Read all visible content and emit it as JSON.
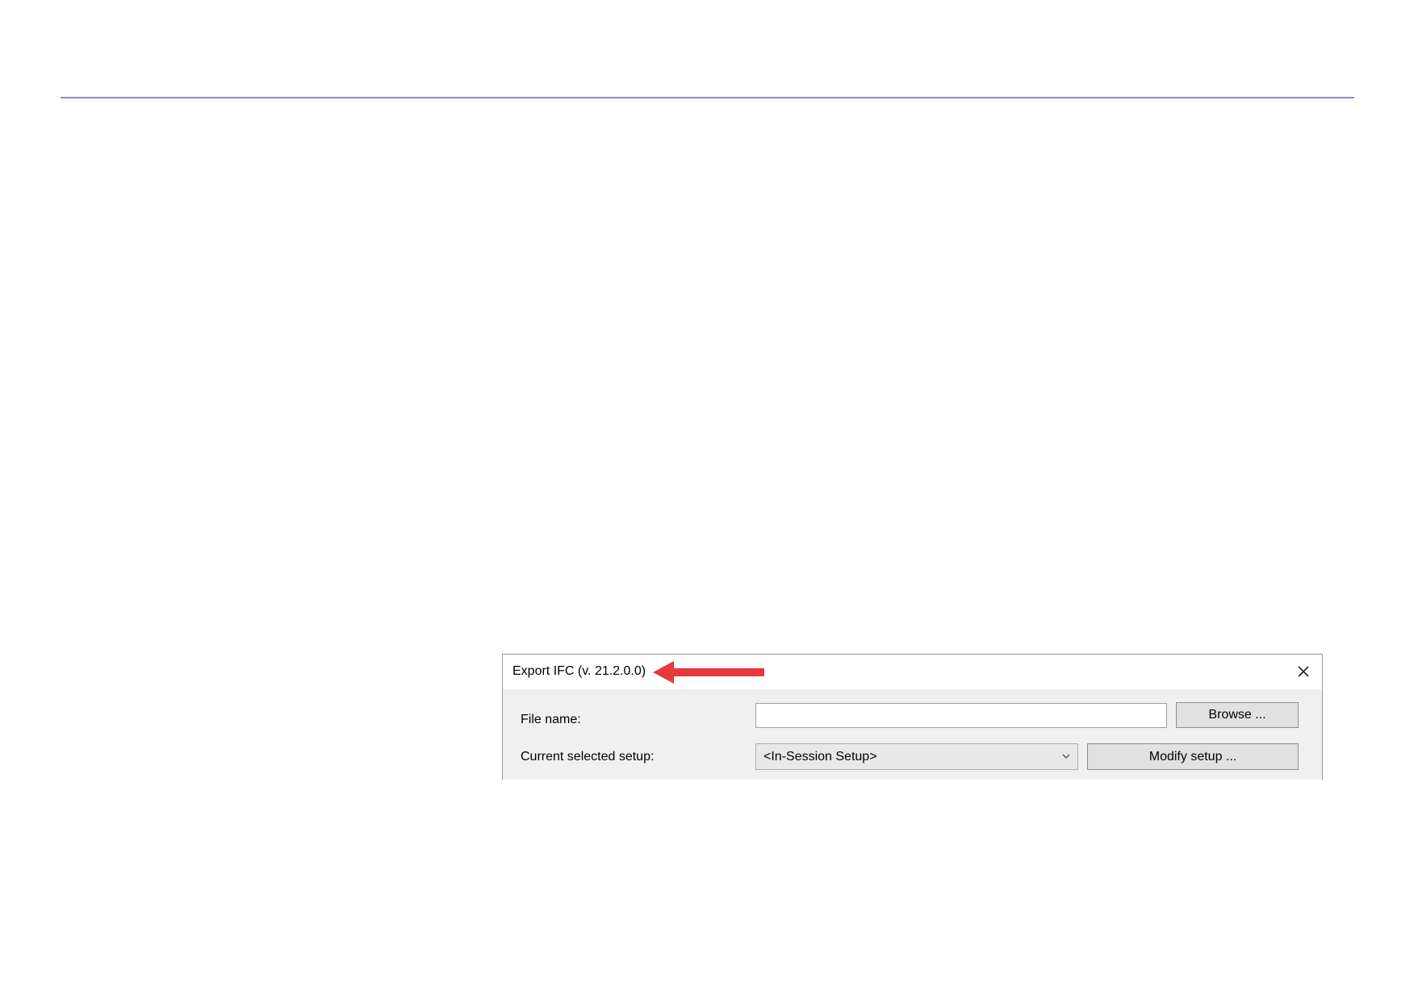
{
  "dialog": {
    "title": "Export IFC (v. 21.2.0.0)",
    "close_icon": "close-icon",
    "annotation_icon": "arrow-left-icon",
    "annotation_color": "#e8383d"
  },
  "fields": {
    "file_name_label": "File name:",
    "file_name_value": "",
    "browse_label": "Browse ...",
    "setup_label": "Current selected setup:",
    "setup_selected": "<In-Session Setup>",
    "modify_label": "Modify setup ..."
  },
  "colors": {
    "rule": "#8e8fbf",
    "dialog_bg": "#f0f0f0",
    "button_bg": "#e1e1e1"
  }
}
